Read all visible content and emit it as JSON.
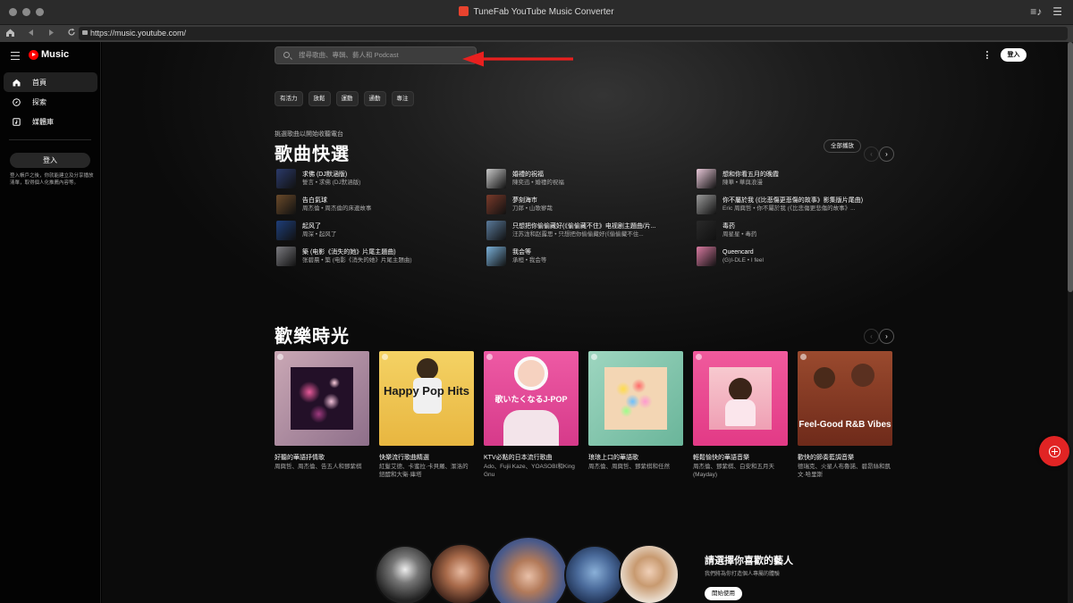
{
  "window": {
    "app_title": "TuneFab YouTube Music Converter",
    "url": "https://music.youtube.com/"
  },
  "colors": {
    "accent_red": "#e12424",
    "annotation_arrow": "#e8201f",
    "background": "#030303"
  },
  "sidebar": {
    "logo_text": "Music",
    "items": [
      {
        "label": "首頁",
        "icon": "home-icon"
      },
      {
        "label": "探索",
        "icon": "compass-icon"
      },
      {
        "label": "媒體庫",
        "icon": "library-icon"
      }
    ],
    "login_label": "登入",
    "note": "登入帳戶之後，你就能建立及分享播放清單，取得個人化推薦內容等。"
  },
  "header": {
    "search_placeholder": "搜尋歌曲、專輯、藝人和 Podcast",
    "login_label": "登入"
  },
  "chips": [
    "有活力",
    "放鬆",
    "運動",
    "通勤",
    "專注"
  ],
  "quick_picks": {
    "subtitle": "挑選歌曲以開始收聽電台",
    "title": "歌曲快選",
    "play_all_label": "全部播放",
    "columns": [
      [
        {
          "title": "求佛 (DJ默涵版)",
          "sub": "誓言 • 求佛 (DJ默涵版)",
          "color": "#2b3a6a"
        },
        {
          "title": "告白氣球",
          "sub": "周杰倫 • 周杰倫的床邊故事",
          "color": "#6a4a2a"
        },
        {
          "title": "起风了",
          "sub": "周深 • 起风了",
          "color": "#1e3e7a"
        },
        {
          "title": "築 (电影《消失的她》片尾主題曲)",
          "sub": "张碧晨 • 築 (电影《消失的她》片尾主題曲)",
          "color": "#7b7b80"
        }
      ],
      [
        {
          "title": "婚禮的祝福",
          "sub": "陳奕迅 • 婚禮的祝福",
          "color": "#c8c8c8"
        },
        {
          "title": "夢刻海市",
          "sub": "刀郎 • 山歌寥哉",
          "color": "#7a3a2a"
        },
        {
          "title": "只想把你偷偷藏好(《偷偷藏不住》电视剧主題曲/片...",
          "sub": "汪苏泷和赵露思 • 只想把你偷偷藏好(《偷偷藏不住...",
          "color": "#5a7a9a"
        },
        {
          "title": "我会等",
          "sub": "承桓 • 我会等",
          "color": "#7ab0d8"
        }
      ],
      [
        {
          "title": "想和你看五月的晚霞",
          "sub": "陳華 • 華與浪漫",
          "color": "#e8c8d8"
        },
        {
          "title": "你不屬於我 (《比悲傷更悲傷的故事》影集版片尾曲)",
          "sub": "Eric 周興哲 • 你不屬於我 (《比悲傷更悲傷的故事》...",
          "color": "#9a9a9a"
        },
        {
          "title": "毒药",
          "sub": "周星星 • 毒药",
          "color": "#2a2a2a"
        },
        {
          "title": "Queencard",
          "sub": "(G)I-DLE • I feel",
          "color": "#d87aa0"
        }
      ]
    ]
  },
  "happy_hour": {
    "title": "歡樂時光",
    "cards": [
      {
        "title": "好聽的華語抒情歌",
        "sub": "周興哲、周杰倫、告五人和鄧紫棋",
        "caption": ""
      },
      {
        "title": "快樂流行歌曲精選",
        "sub": "紅髮艾德、卡蜜拉·卡貝羅、潔洛的鈕醍和大衛·庫塔",
        "caption": "Happy Pop Hits"
      },
      {
        "title": "KTV必點的日本流行歌曲",
        "sub": "Ado、Fujii Kaze、YOASOBI和King Gnu",
        "caption": "歌いたくなるJ-POP"
      },
      {
        "title": "琅琅上口的華語歌",
        "sub": "周杰倫、周興哲、鄧紫棋和任然",
        "caption": ""
      },
      {
        "title": "輕鬆愉快的華語音樂",
        "sub": "周杰倫、鄧紫棋、白安和五月天 (Mayday)",
        "caption": ""
      },
      {
        "title": "歡快的節奏藍調音樂",
        "sub": "德瑞克、火星人布魯諾、碧昂絲和凱文·哈里斯",
        "caption": "Feel-Good R&B Vibes"
      }
    ]
  },
  "artist_prompt": {
    "title": "請選擇你喜歡的藝人",
    "sub": "我們將為你打造個人專屬的體驗",
    "button_label": "開始使用"
  }
}
